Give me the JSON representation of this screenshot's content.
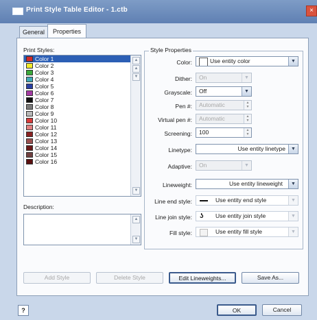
{
  "window": {
    "title": "Print Style Table Editor - 1.ctb",
    "close_glyph": "×"
  },
  "tabs": [
    {
      "label": "General"
    },
    {
      "label": "Properties"
    }
  ],
  "print_styles": {
    "label": "Print Styles:",
    "items": [
      {
        "label": "Color 1",
        "color": "#d42a2a",
        "selected": true
      },
      {
        "label": "Color 2",
        "color": "#f2ea2a"
      },
      {
        "label": "Color 3",
        "color": "#3aa93a"
      },
      {
        "label": "Color 4",
        "color": "#3fa9b7"
      },
      {
        "label": "Color 5",
        "color": "#2a3fa5"
      },
      {
        "label": "Color 6",
        "color": "#a43aa4"
      },
      {
        "label": "Color 7",
        "color": "#111111"
      },
      {
        "label": "Color 8",
        "color": "#7a7a7a"
      },
      {
        "label": "Color 9",
        "color": "#b8b8b8"
      },
      {
        "label": "Color 10",
        "color": "#d93a3a"
      },
      {
        "label": "Color 11",
        "color": "#e08080"
      },
      {
        "label": "Color 12",
        "color": "#8a2222"
      },
      {
        "label": "Color 13",
        "color": "#9a5050"
      },
      {
        "label": "Color 14",
        "color": "#6a1818"
      },
      {
        "label": "Color 15",
        "color": "#704040"
      },
      {
        "label": "Color 16",
        "color": "#5a1010"
      }
    ]
  },
  "description": {
    "label": "Description:",
    "value": ""
  },
  "style_properties": {
    "title": "Style Properties",
    "color": {
      "label": "Color:",
      "value": "Use entity color"
    },
    "dither": {
      "label": "Dither:",
      "value": "On"
    },
    "grayscale": {
      "label": "Grayscale:",
      "value": "Off"
    },
    "pen": {
      "label": "Pen #:",
      "value": "Automatic"
    },
    "virtual_pen": {
      "label": "Virtual pen #:",
      "value": "Automatic"
    },
    "screening": {
      "label": "Screening:",
      "value": "100"
    },
    "linetype": {
      "label": "Linetype:",
      "value": "Use entity linetype"
    },
    "adaptive": {
      "label": "Adaptive:",
      "value": "On"
    },
    "lineweight": {
      "label": "Lineweight:",
      "value": "Use entity lineweight"
    },
    "line_end": {
      "label": "Line end style:",
      "value": "Use entity end style"
    },
    "line_join": {
      "label": "Line join style:",
      "value": "Use entity join style"
    },
    "fill": {
      "label": "Fill style:",
      "value": "Use entity fill style"
    }
  },
  "buttons": {
    "add_style": "Add Style",
    "delete_style": "Delete Style",
    "edit_lineweights": "Edit Lineweights...",
    "save_as": "Save As...",
    "ok": "OK",
    "cancel": "Cancel",
    "help": "?"
  }
}
